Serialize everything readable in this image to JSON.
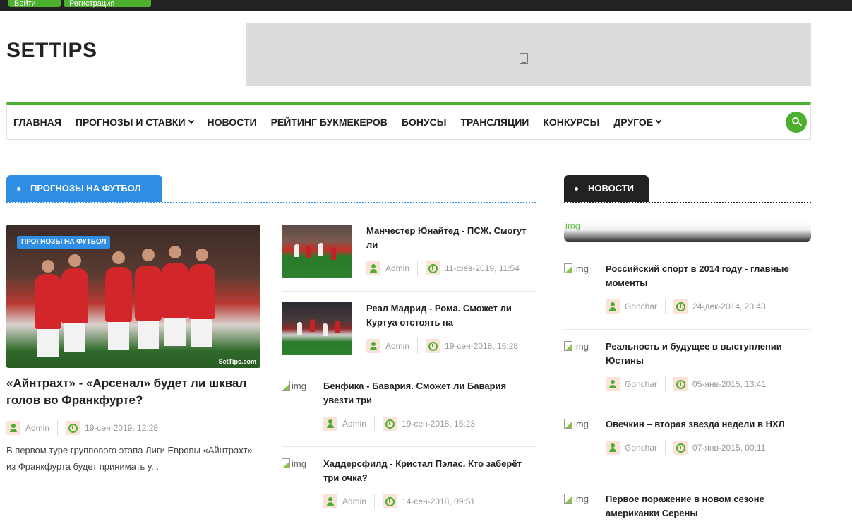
{
  "topbar": {
    "login_label": "Войти",
    "register_label": "Регистрация"
  },
  "header": {
    "logo": "SETTIPS"
  },
  "nav": {
    "items": [
      {
        "label": "ГЛАВНАЯ",
        "dropdown": false
      },
      {
        "label": "ПРОГНОЗЫ И СТАВКИ",
        "dropdown": true
      },
      {
        "label": "НОВОСТИ",
        "dropdown": false
      },
      {
        "label": "РЕЙТИНГ БУКМЕКЕРОВ",
        "dropdown": false
      },
      {
        "label": "БОНУСЫ",
        "dropdown": false
      },
      {
        "label": "ТРАНСЛЯЦИИ",
        "dropdown": false
      },
      {
        "label": "КОНКУРСЫ",
        "dropdown": false
      },
      {
        "label": "ДРУГОЕ",
        "dropdown": true
      }
    ],
    "search_icon": "search-icon"
  },
  "football": {
    "section_title": "ПРОГНОЗЫ НА ФУТБОЛ",
    "featured": {
      "badge": "ПРОГНОЗЫ НА ФУТБОЛ",
      "watermark": "SetTips.com",
      "title": "«Айнтрахт» - «Арсенал» будет ли шквал голов во Франкфурте?",
      "author": "Admin",
      "date": "19-сен-2019, 12:28",
      "excerpt": "В первом туре группового этапа Лиги Европы «Айнтрахт» из Франкфурта будет принимать у..."
    },
    "items": [
      {
        "title": "Манчестер Юнайтед - ПСЖ. Смогут ли",
        "author": "Admin",
        "date": "11-фев-2019, 11:54",
        "image": "thumb"
      },
      {
        "title": "Реал Мадрид - Рома. Сможет ли Куртуа отстоять на",
        "author": "Admin",
        "date": "19-сен-2018, 16:28",
        "image": "thumb"
      },
      {
        "title": "Бенфика - Бавария. Сможет ли Бавария увезти три",
        "author": "Admin",
        "date": "19-сен-2018, 15:23",
        "image_alt": "img"
      },
      {
        "title": "Хаддерсфилд - Кристал Пэлас. Кто заберёт три очка?",
        "author": "Admin",
        "date": "14-сен-2018, 09:51",
        "image_alt": "img"
      }
    ]
  },
  "news": {
    "section_title": "НОВОСТИ",
    "banner_alt": "img",
    "items": [
      {
        "title": "Российский спорт в 2014 году - главные моменты",
        "author": "Gonchar",
        "date": "24-дек-2014, 20:43",
        "image_alt": "img"
      },
      {
        "title": "Реальность и будущее в выступлении Юстины",
        "author": "Gonchar",
        "date": "05-янв-2015, 13:41",
        "image_alt": "img"
      },
      {
        "title": "Овечкин – вторая звезда недели в НХЛ",
        "author": "Gonchar",
        "date": "07-янв-2015, 00:11",
        "image_alt": "img"
      },
      {
        "title": "Первое поражение в новом сезоне американки Серены",
        "image_alt": "img"
      }
    ]
  },
  "colors": {
    "accent_green": "#4caf2e",
    "accent_blue": "#2f8de4",
    "dark": "#222222"
  }
}
